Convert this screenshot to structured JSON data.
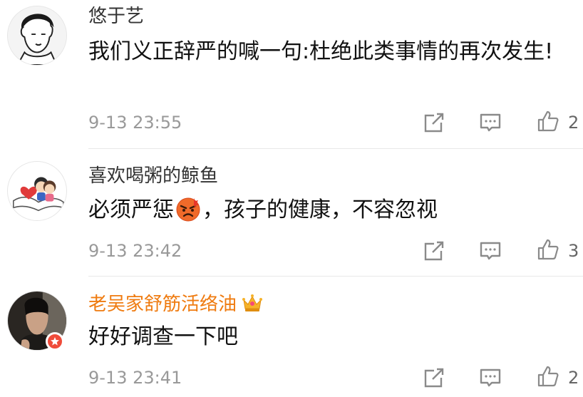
{
  "comments": [
    {
      "username": "悠于艺",
      "text": "我们义正辞严的喊一句:杜绝此类事情的再次发生!",
      "time": "9-13 23:55",
      "likes": "2"
    },
    {
      "username": "喜欢喝粥的鲸鱼",
      "text_before": "必须严惩",
      "text_after": "，孩子的健康，不容忽视",
      "time": "9-13 23:42",
      "likes": "3"
    },
    {
      "username": "老吴家舒筋活络油",
      "text": "好好调查一下吧",
      "time": "9-13 23:41",
      "likes": "2"
    }
  ],
  "colors": {
    "username": "#333333",
    "vip_username": "#ef7b10",
    "text": "#111111",
    "meta": "#999999",
    "icon": "#8a8a8a",
    "badge": "#ef4b3a"
  },
  "icons": {
    "share": "share-icon",
    "reply": "comment-icon",
    "like": "thumbs-up-icon",
    "vip": "crown-icon",
    "verified": "verified-badge-icon",
    "emoji": "angry-face-emoji"
  }
}
